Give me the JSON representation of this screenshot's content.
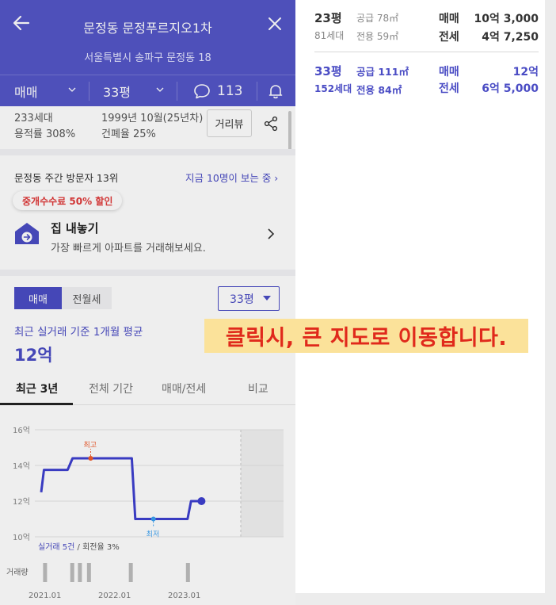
{
  "header": {
    "title": "문정동 문정푸르지오1차",
    "address": "서울특별시 송파구 문정동 18",
    "filters": {
      "trade_type": "매매",
      "size": "33평",
      "comment_count": "113"
    }
  },
  "info": {
    "households": "233세대",
    "built": "1999년 10월(25년차)",
    "far": "용적률 308%",
    "bcr": "건폐율 25%",
    "distance_view_label": "거리뷰"
  },
  "visitors": {
    "weekly": "문정동 주간 방문자 13위",
    "now": "지금 10명이 보는 중 ›"
  },
  "listing": {
    "badge": "중개수수료 50% 할인",
    "title": "집 내놓기",
    "subtitle": "가장 빠르게 아파트를 거래해보세요."
  },
  "price": {
    "tabs": [
      "매매",
      "전월세"
    ],
    "size_select": "33평",
    "avg_label": "최근 실거래 기준 1개월 평균",
    "avg_value": "12억",
    "period_tabs": [
      "최근 3년",
      "전체 기간",
      "매매/전세",
      "비교"
    ]
  },
  "chart_data": {
    "type": "line",
    "y_ticks": [
      "16억",
      "14억",
      "12억",
      "10억"
    ],
    "ylim": [
      10,
      16
    ],
    "x_ticks": [
      "2021.01",
      "2022.01",
      "2023.01"
    ],
    "series": [
      {
        "values": [
          [
            0,
            12.5
          ],
          [
            0.04,
            13.75
          ],
          [
            0.38,
            13.75
          ],
          [
            0.45,
            14.4
          ],
          [
            1.3,
            14.4
          ],
          [
            1.35,
            11.0
          ],
          [
            2.1,
            11.0
          ],
          [
            2.15,
            12.0
          ],
          [
            2.3,
            12.0
          ]
        ]
      }
    ],
    "annotations": {
      "high": "최고",
      "low": "최저"
    },
    "volume_label": "거래량",
    "volume_bars": [
      0.05,
      0.44,
      0.55,
      0.68,
      1.28,
      2.1
    ],
    "footnote": {
      "main": "실거래 5건",
      "rest": " / 회전율 3%"
    },
    "colors": {
      "line": "#3d3fcf",
      "high": "#f05a2a",
      "low": "#3aa0f0"
    }
  },
  "right_panel": {
    "rows": [
      {
        "pyeong": "23평",
        "households": "81세대",
        "supply": "공급 78㎡",
        "exclusive": "전용 59㎡",
        "trade_label": "매매",
        "trade_price": "10억 3,000",
        "jeonse_label": "전세",
        "jeonse_price": "4억 7,250"
      },
      {
        "pyeong": "33평",
        "households": "152세대",
        "supply": "공급 111㎡",
        "exclusive": "전용 84㎡",
        "trade_label": "매매",
        "trade_price": "12억",
        "jeonse_label": "전세",
        "jeonse_price": "6억 5,000"
      }
    ]
  },
  "callout": "클릭시, 큰 지도로 이동합니다.",
  "colors": {
    "brand": "#5355c8",
    "accent": "#3d3fcf",
    "alert": "#e0291b"
  }
}
